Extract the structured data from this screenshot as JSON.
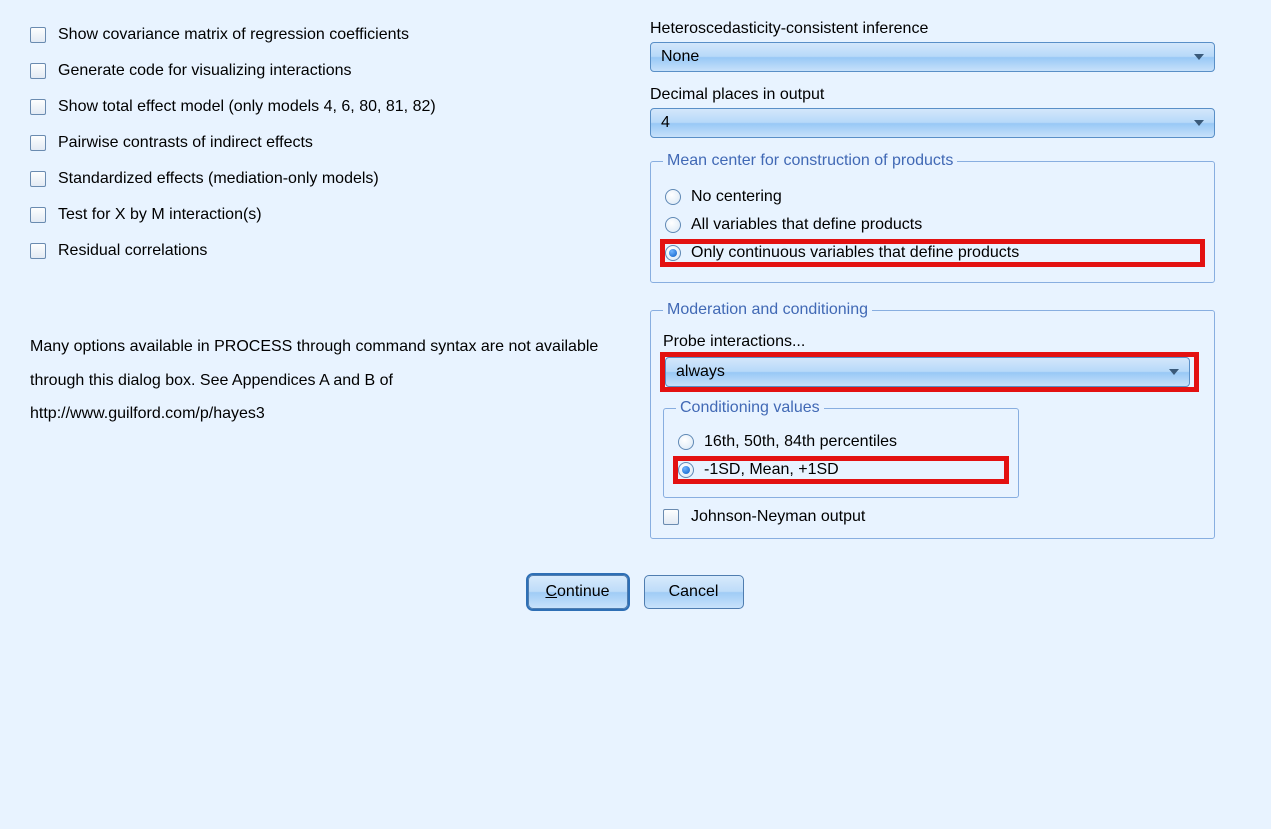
{
  "checkboxes": {
    "covariance": "Show covariance matrix of regression coefficients",
    "codegen": "Generate code for visualizing interactions",
    "total_effect": "Show total effect model (only models 4, 6, 80, 81, 82)",
    "pairwise": "Pairwise contrasts of indirect effects",
    "standardized": "Standardized effects (mediation-only models)",
    "xm_interaction": "Test for X by M interaction(s)",
    "residual": "Residual correlations"
  },
  "note": "Many options available in PROCESS through command syntax are not available through this dialog box.  See Appendices A and B of http://www.guilford.com/p/hayes3",
  "hetero": {
    "label": "Heteroscedasticity-consistent inference",
    "value": "None"
  },
  "decimals": {
    "label": "Decimal places in output",
    "value": "4"
  },
  "centering": {
    "legend": "Mean center for construction of products",
    "opt_none": "No centering",
    "opt_all": "All variables that define products",
    "opt_cont": "Only continuous variables that define products"
  },
  "moderation": {
    "legend": "Moderation and conditioning",
    "probe_label": "Probe interactions...",
    "probe_value": "always",
    "cond_legend": "Conditioning values",
    "cond_percentiles": "16th, 50th, 84th percentiles",
    "cond_sd": "-1SD, Mean, +1SD",
    "jn": "Johnson-Neyman output"
  },
  "buttons": {
    "continue": "Continue",
    "cancel": "Cancel"
  }
}
